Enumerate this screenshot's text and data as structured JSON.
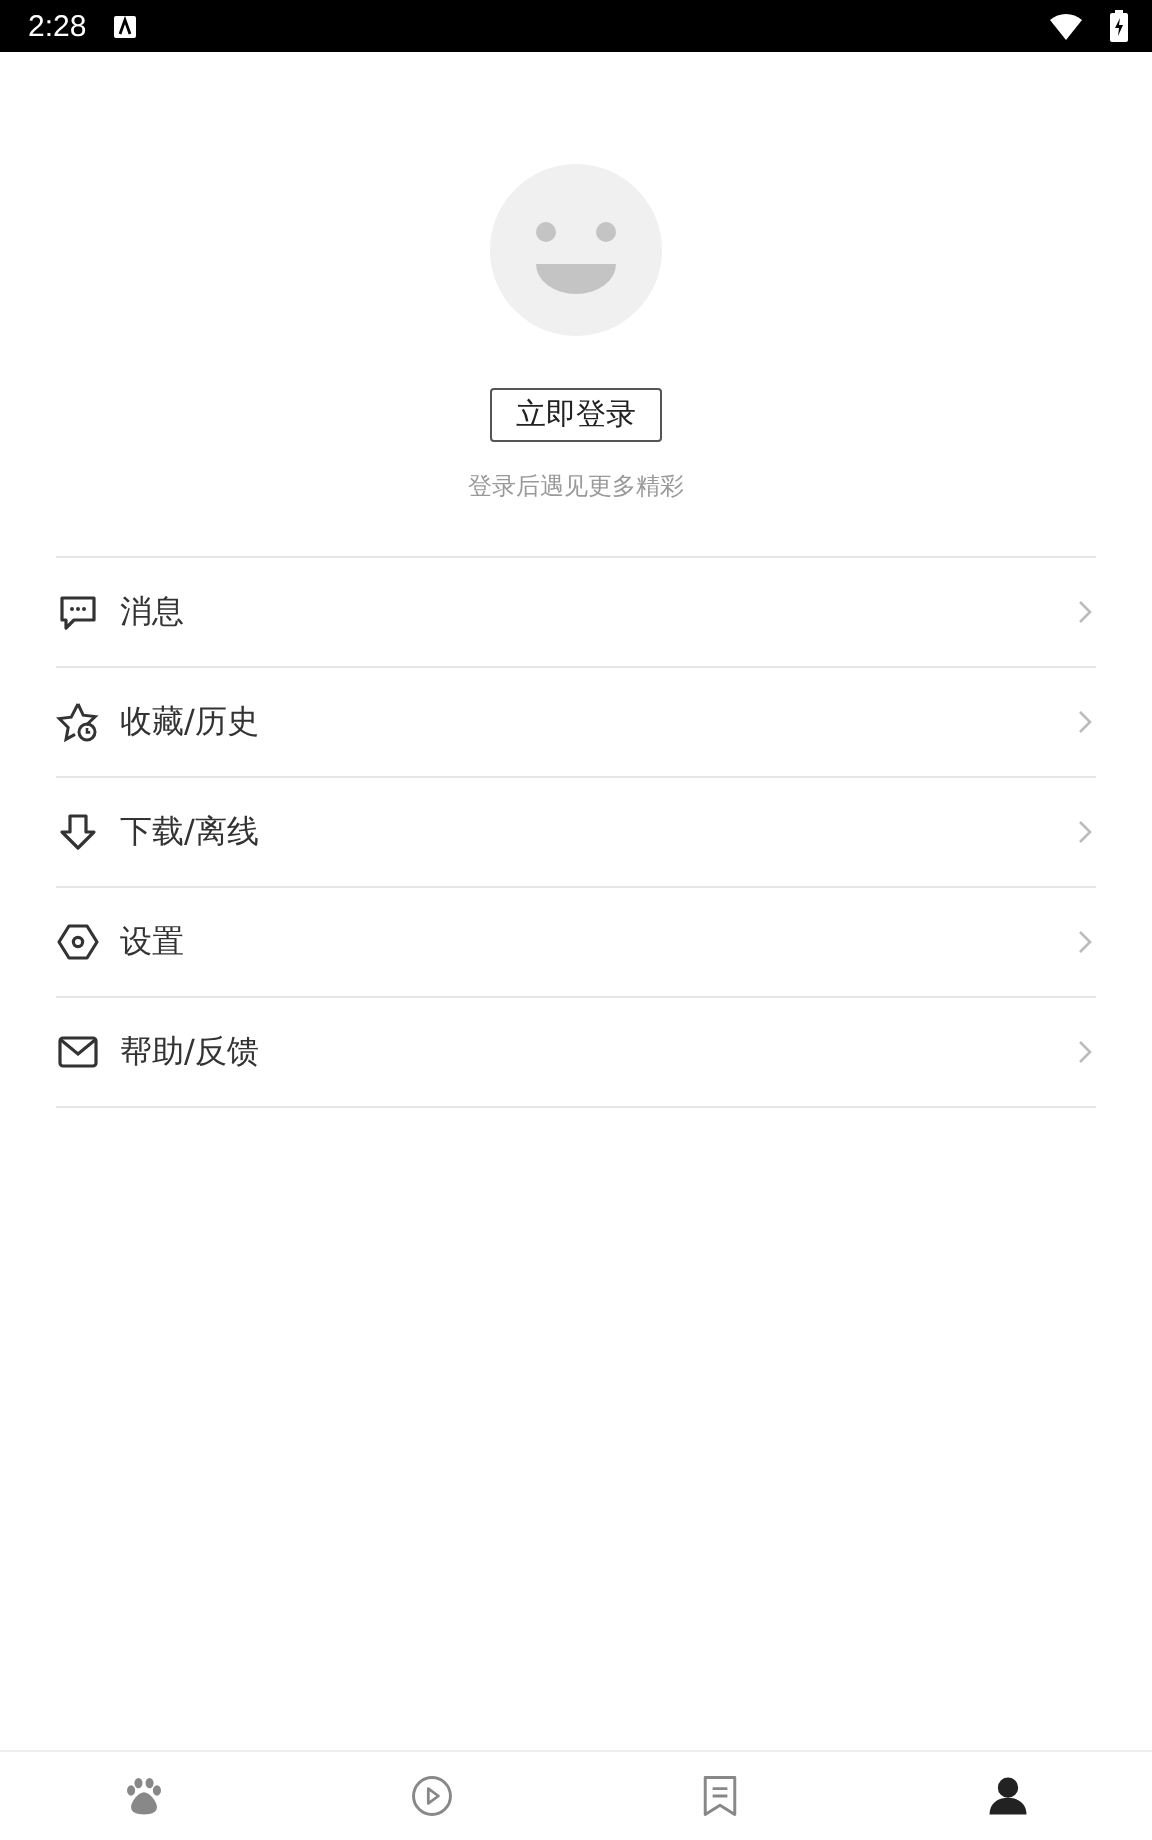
{
  "status_bar": {
    "time": "2:28"
  },
  "login": {
    "button": "立即登录",
    "hint": "登录后遇见更多精彩"
  },
  "menu": [
    {
      "kind": "message",
      "label": "消息"
    },
    {
      "kind": "favorite",
      "label": "收藏/历史"
    },
    {
      "kind": "download",
      "label": "下载/离线"
    },
    {
      "kind": "settings",
      "label": "设置"
    },
    {
      "kind": "mail",
      "label": "帮助/反馈"
    }
  ],
  "bottom_nav": [
    {
      "kind": "paw",
      "selected": false
    },
    {
      "kind": "play",
      "selected": false
    },
    {
      "kind": "bookmark",
      "selected": false
    },
    {
      "kind": "person",
      "selected": true
    }
  ]
}
